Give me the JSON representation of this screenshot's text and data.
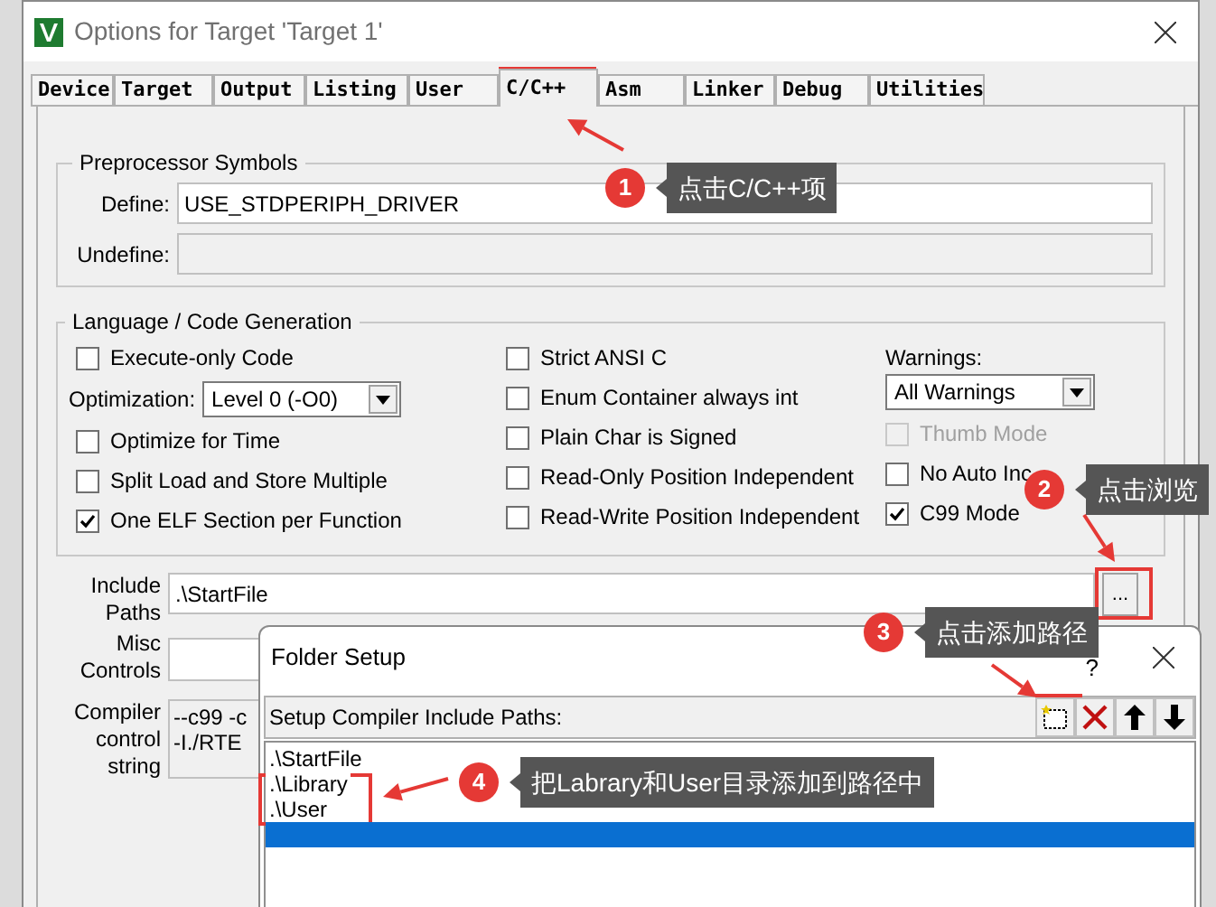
{
  "window": {
    "title": "Options for Target 'Target 1'"
  },
  "tabs": [
    {
      "label": "Device",
      "selected": false
    },
    {
      "label": "Target",
      "selected": false
    },
    {
      "label": "Output",
      "selected": false
    },
    {
      "label": "Listing",
      "selected": false
    },
    {
      "label": "User",
      "selected": false
    },
    {
      "label": "C/C++",
      "selected": true
    },
    {
      "label": "Asm",
      "selected": false
    },
    {
      "label": "Linker",
      "selected": false
    },
    {
      "label": "Debug",
      "selected": false
    },
    {
      "label": "Utilities",
      "selected": false
    }
  ],
  "preprocessor": {
    "title": "Preprocessor Symbols",
    "define": {
      "label": "Define:",
      "value": "USE_STDPERIPH_DRIVER"
    },
    "undefine": {
      "label": "Undefine:"
    }
  },
  "language": {
    "title": "Language / Code Generation",
    "columns": [
      [
        {
          "kind": "checkbox",
          "label": "Execute-only Code",
          "checked": false
        },
        {
          "kind": "select",
          "label": "Optimization:",
          "value": "Level 0 (-O0)"
        },
        {
          "kind": "checkbox",
          "label": "Optimize for Time",
          "checked": false
        },
        {
          "kind": "checkbox",
          "label": "Split Load and Store Multiple",
          "checked": false
        },
        {
          "kind": "checkbox",
          "label": "One ELF Section per Function",
          "checked": true
        }
      ],
      [
        {
          "kind": "checkbox",
          "label": "Strict ANSI C",
          "checked": false
        },
        {
          "kind": "checkbox",
          "label": "Enum Container always int",
          "checked": false
        },
        {
          "kind": "checkbox",
          "label": "Plain Char is Signed",
          "checked": false
        },
        {
          "kind": "checkbox",
          "label": "Read-Only Position Independent",
          "checked": false
        },
        {
          "kind": "checkbox",
          "label": "Read-Write Position Independent",
          "checked": false
        }
      ],
      [
        {
          "kind": "caption",
          "label": "Warnings:"
        },
        {
          "kind": "select",
          "value": "All Warnings"
        },
        {
          "kind": "checkbox",
          "label": "Thumb Mode",
          "checked": false,
          "disabled": true
        },
        {
          "kind": "checkbox",
          "label": "No Auto Inc",
          "checked": false,
          "disabled": false
        },
        {
          "kind": "checkbox",
          "label": "C99 Mode",
          "checked": true,
          "disabled": false
        }
      ]
    ]
  },
  "include_paths": {
    "label": "Include Paths",
    "value": ".\\StartFile",
    "browse": "..."
  },
  "misc_controls": {
    "label": "Misc Controls"
  },
  "compiler_string": {
    "label": "Compiler control string",
    "lines": [
      "--c99 -c",
      "-I./RTE"
    ]
  },
  "folder_setup": {
    "title": "Folder Setup",
    "help": "?",
    "toolbar_label": "Setup Compiler Include Paths:",
    "tools": [
      {
        "kind": "new"
      },
      {
        "kind": "delete"
      },
      {
        "kind": "up"
      },
      {
        "kind": "down"
      }
    ],
    "items": [
      {
        "text": ".\\StartFile",
        "selected": false
      },
      {
        "text": ".\\Library",
        "selected": false
      },
      {
        "text": ".\\User",
        "selected": false
      },
      {
        "selected": true
      }
    ]
  },
  "annotations": [
    {
      "number": "1",
      "text": "点击C/C++项"
    },
    {
      "number": "2",
      "text": "点击浏览"
    },
    {
      "number": "3",
      "text": "点击添加路径"
    },
    {
      "number": "4",
      "text": "把Labrary和User目录添加到路径中"
    }
  ]
}
